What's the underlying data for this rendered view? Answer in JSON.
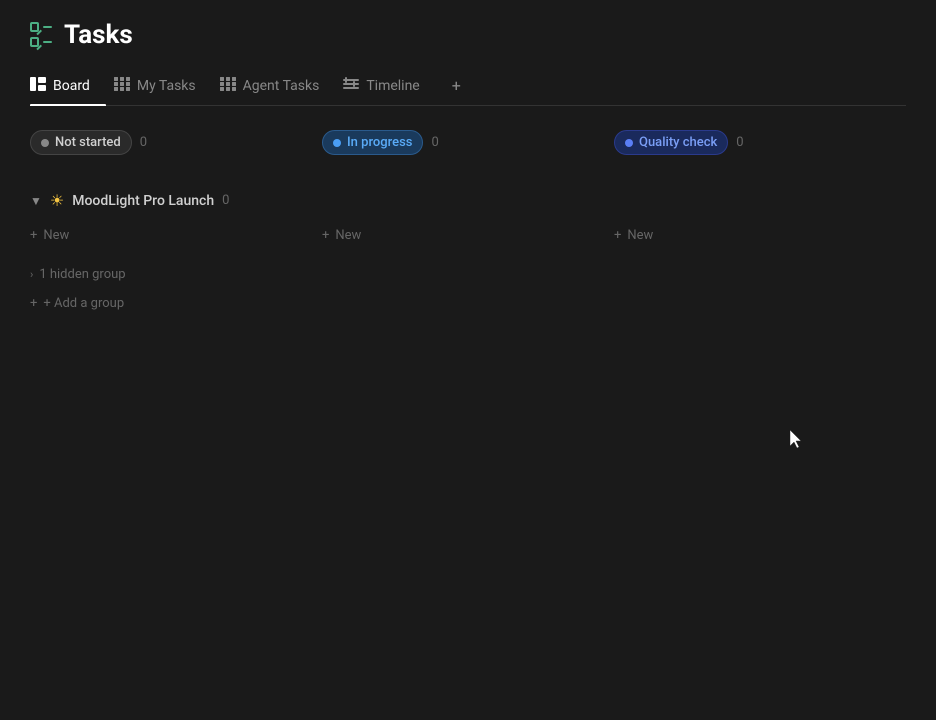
{
  "page": {
    "title": "Tasks"
  },
  "tabs": [
    {
      "id": "board",
      "label": "Board",
      "active": true,
      "icon": "board-icon"
    },
    {
      "id": "my-tasks",
      "label": "My Tasks",
      "active": false,
      "icon": "grid-icon"
    },
    {
      "id": "agent-tasks",
      "label": "Agent Tasks",
      "active": false,
      "icon": "grid-icon"
    },
    {
      "id": "timeline",
      "label": "Timeline",
      "active": false,
      "icon": "timeline-icon"
    }
  ],
  "columns": [
    {
      "id": "not-started",
      "status_label": "Not started",
      "count": "0",
      "badge_class": "badge-not-started"
    },
    {
      "id": "in-progress",
      "status_label": "In progress",
      "count": "0",
      "badge_class": "badge-in-progress"
    },
    {
      "id": "quality-check",
      "status_label": "Quality check",
      "count": "0",
      "badge_class": "badge-quality-check"
    }
  ],
  "project": {
    "name": "MoodLight Pro Launch",
    "count": "0"
  },
  "new_task_label": "+ New",
  "hidden_group_label": "1 hidden group",
  "add_group_label": "+ Add a group",
  "colors": {
    "accent_green": "#4caf84",
    "not_started_dot": "#888888",
    "in_progress_dot": "#4a9ef5",
    "quality_check_dot": "#5a7ef5"
  }
}
